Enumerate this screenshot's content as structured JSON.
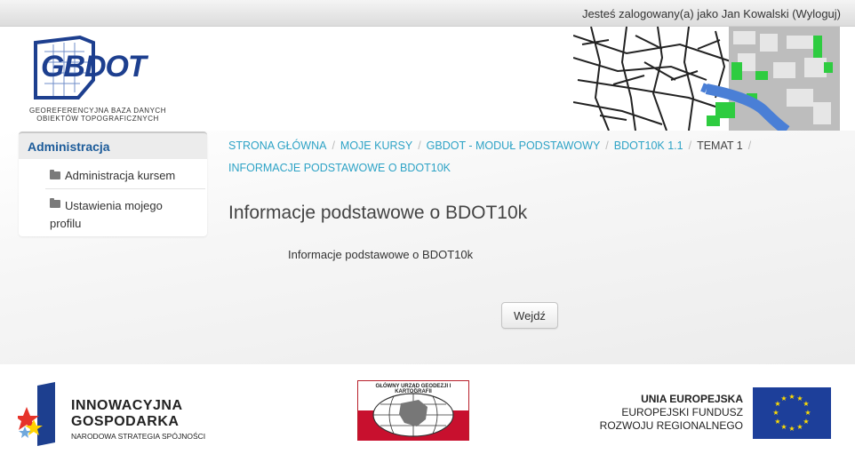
{
  "header": {
    "login_text": "Jesteś zalogowany(a) jako Jan Kowalski (Wyloguj)",
    "logo_word": "GBDOT",
    "logo_sub_line1": "GEOREFERENCYJNA BAZA DANYCH",
    "logo_sub_line2": "OBIEKTÓW TOPOGRAFICZNYCH"
  },
  "sidebar": {
    "title": "Administracja",
    "items": [
      {
        "label": "Administracja kursem",
        "icon": "folder-icon"
      },
      {
        "label": "Ustawienia mojego profilu",
        "icon": "folder-icon"
      }
    ]
  },
  "breadcrumb": {
    "items": [
      {
        "label": "STRONA GŁÓWNA"
      },
      {
        "label": "MOJE KURSY"
      },
      {
        "label": "GBDOT - MODUŁ PODSTAWOWY"
      },
      {
        "label": "BDOT10K 1.1"
      },
      {
        "label": "TEMAT 1"
      },
      {
        "label": "INFORMACJE PODSTAWOWE O BDOT10K"
      }
    ]
  },
  "main": {
    "title": "Informacje podstawowe o BDOT10k",
    "text": "Informacje podstawowe o BDOT10k",
    "enter_button": "Wejdź"
  },
  "footer": {
    "ig_line1": "INNOWACYJNA",
    "ig_line2": "GOSPODARKA",
    "ig_line3": "NARODOWA STRATEGIA SPÓJNOŚCI",
    "gugik_text": "GŁÓWNY URZĄD GEODEZJI I KARTOGRAFII",
    "eu_line1": "UNIA EUROPEJSKA",
    "eu_line2": "EUROPEJSKI FUNDUSZ",
    "eu_line3": "ROZWOJU REGIONALNEGO"
  },
  "colors": {
    "link": "#2ea3c6",
    "brand_blue": "#1d3f8f",
    "sidebar_title": "#1d5c9a",
    "eu_blue": "#1d3f9a",
    "eu_star": "#ffdd00"
  }
}
